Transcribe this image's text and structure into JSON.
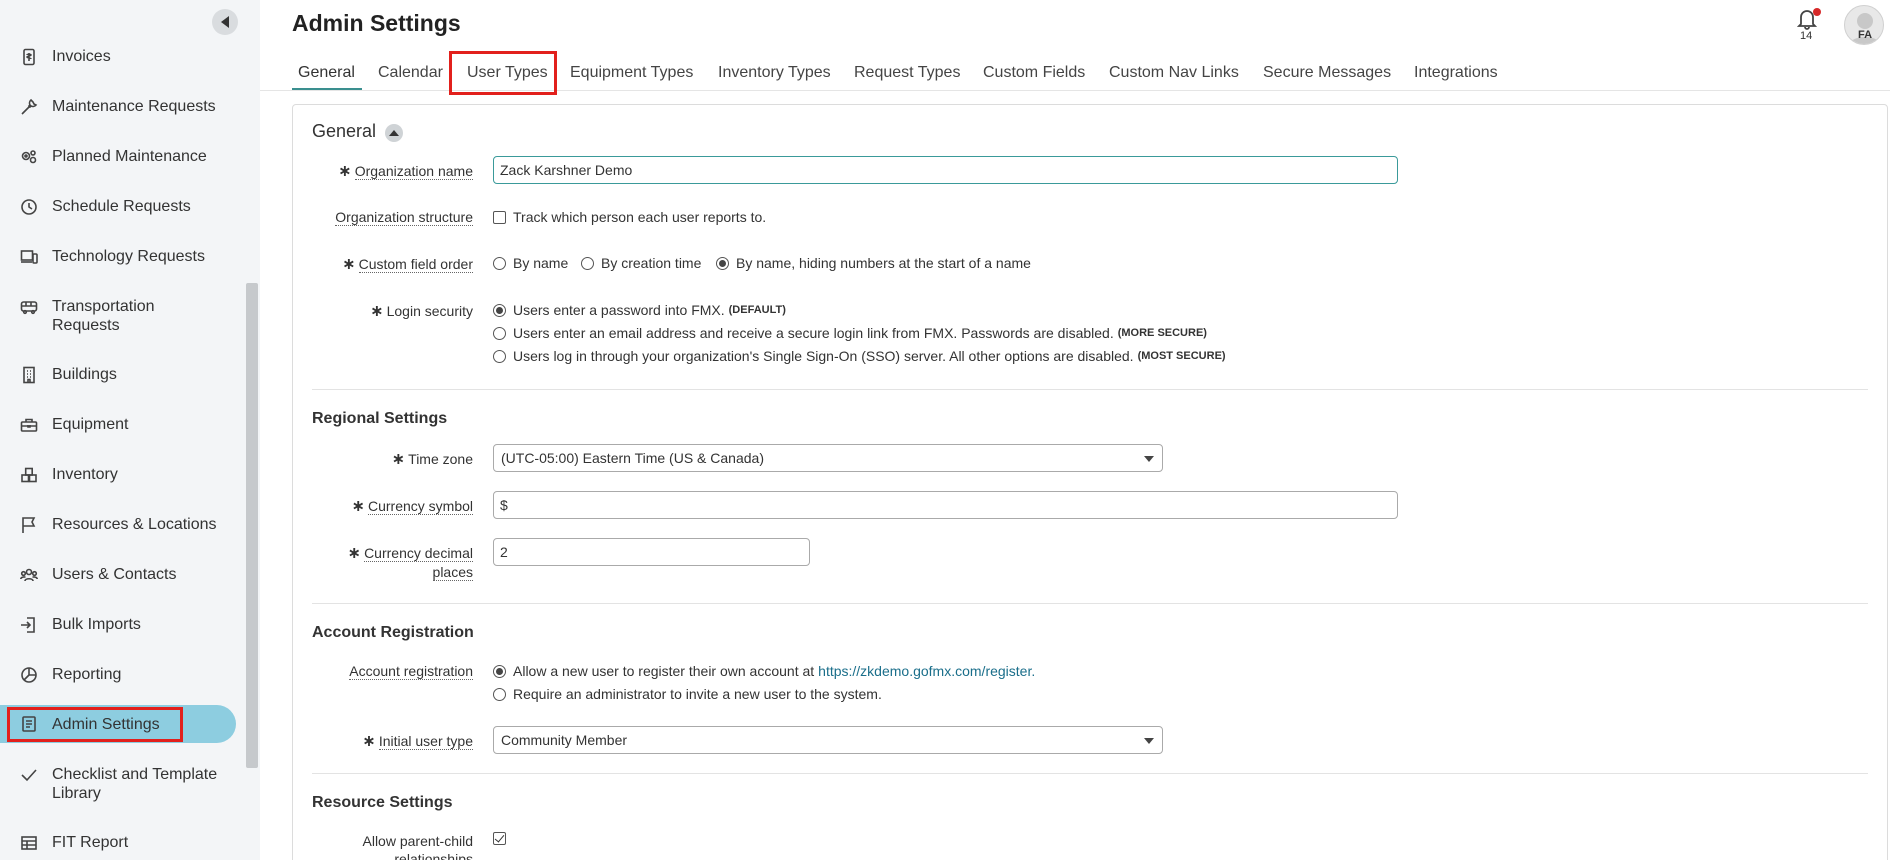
{
  "sidebar": {
    "items": [
      {
        "label": "Invoices",
        "icon": "invoice-icon"
      },
      {
        "label": "Maintenance Requests",
        "icon": "wrench-icon"
      },
      {
        "label": "Planned Maintenance",
        "icon": "gears-icon"
      },
      {
        "label": "Schedule Requests",
        "icon": "clock-icon"
      },
      {
        "label": "Technology Requests",
        "icon": "devices-icon"
      },
      {
        "label": "Transportation Requests",
        "icon": "bus-icon"
      },
      {
        "label": "Buildings",
        "icon": "building-icon"
      },
      {
        "label": "Equipment",
        "icon": "toolbox-icon"
      },
      {
        "label": "Inventory",
        "icon": "boxes-icon"
      },
      {
        "label": "Resources & Locations",
        "icon": "flag-icon"
      },
      {
        "label": "Users & Contacts",
        "icon": "users-icon"
      },
      {
        "label": "Bulk Imports",
        "icon": "import-icon"
      },
      {
        "label": "Reporting",
        "icon": "pie-chart-icon"
      },
      {
        "label": "Admin Settings",
        "icon": "settings-doc-icon"
      },
      {
        "label": "Checklist and Template Library",
        "icon": "checkmark-icon"
      },
      {
        "label": "FIT Report",
        "icon": "table-icon"
      }
    ],
    "active_item": "Admin Settings"
  },
  "header": {
    "title": "Admin Settings",
    "notification_count": "14",
    "avatar_initials": "FA"
  },
  "tabs": [
    "General",
    "Calendar",
    "User Types",
    "Equipment Types",
    "Inventory Types",
    "Request Types",
    "Custom Fields",
    "Custom Nav Links",
    "Secure Messages",
    "Integrations"
  ],
  "active_tab": "General",
  "general": {
    "title": "General",
    "org_name_label": "Organization name",
    "org_name_value": "Zack Karshner Demo",
    "org_structure_label": "Organization structure",
    "org_structure_option": "Track which person each user reports to.",
    "custom_field_order_label": "Custom field order",
    "custom_field_order_options": [
      "By name",
      "By creation time",
      "By name, hiding numbers at the start of a name"
    ],
    "custom_field_order_selected": 2,
    "login_security_label": "Login security",
    "login_security_options": [
      {
        "text": "Users enter a password into FMX.",
        "tag": "(DEFAULT)"
      },
      {
        "text": "Users enter an email address and receive a secure login link from FMX. Passwords are disabled.",
        "tag": "(MORE SECURE)"
      },
      {
        "text": "Users log in through your organization's Single Sign-On (SSO) server. All other options are disabled.",
        "tag": "(MOST SECURE)"
      }
    ],
    "login_security_selected": 0
  },
  "regional": {
    "title": "Regional Settings",
    "time_zone_label": "Time zone",
    "time_zone_value": "(UTC-05:00) Eastern Time (US & Canada)",
    "currency_symbol_label": "Currency symbol",
    "currency_symbol_value": "$",
    "currency_decimal_label_1": "Currency decimal",
    "currency_decimal_label_2": "places",
    "currency_decimal_value": "2"
  },
  "account": {
    "title": "Account Registration",
    "registration_label": "Account registration",
    "registration_options": [
      {
        "text": "Allow a new user to register their own account at",
        "link": "https://zkdemo.gofmx.com/register."
      },
      {
        "text": "Require an administrator to invite a new user to the system."
      }
    ],
    "registration_selected": 0,
    "initial_user_type_label": "Initial user type",
    "initial_user_type_value": "Community Member"
  },
  "resource": {
    "title": "Resource Settings",
    "parent_child_label_1": "Allow parent-child",
    "parent_child_label_2": "relationships",
    "parent_child_checked": true
  },
  "colors": {
    "accent": "#3a8f8f",
    "active_nav": "#8dcde0",
    "highlight": "#e2201c"
  }
}
